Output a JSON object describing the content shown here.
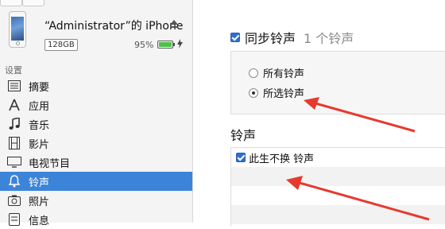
{
  "device": {
    "name": "“Administrator”的 iPhone",
    "capacity": "128GB",
    "battery": "95%"
  },
  "sidebar": {
    "section_label": "设置",
    "items": [
      {
        "label": "摘要",
        "icon": "summary-icon"
      },
      {
        "label": "应用",
        "icon": "apps-icon"
      },
      {
        "label": "音乐",
        "icon": "music-icon"
      },
      {
        "label": "影片",
        "icon": "film-icon"
      },
      {
        "label": "电视节目",
        "icon": "tv-icon"
      },
      {
        "label": "铃声",
        "icon": "bell-icon"
      },
      {
        "label": "照片",
        "icon": "camera-icon"
      },
      {
        "label": "信息",
        "icon": "info-icon"
      }
    ],
    "active": "铃声"
  },
  "main": {
    "sync_label": "同步铃声",
    "sync_count": "1 个铃声",
    "sync_checked": true,
    "options": [
      {
        "label": "所有铃声",
        "selected": false
      },
      {
        "label": "所选铃声",
        "selected": true
      }
    ],
    "list_title": "铃声",
    "ringtones": [
      {
        "label": "此生不换 铃声",
        "checked": true
      }
    ]
  },
  "colors": {
    "accent": "#3c84d8",
    "annotation_arrow": "#e63a2e"
  }
}
